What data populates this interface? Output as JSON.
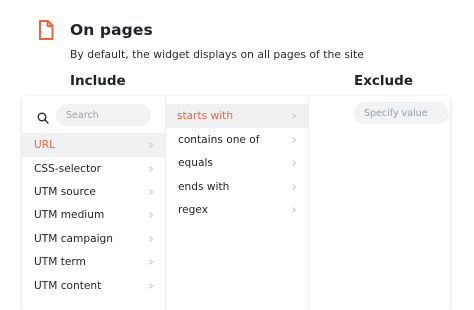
{
  "header": {
    "title": "On pages",
    "subtitle": "By default, the widget displays on all pages of the site",
    "icon": "file-icon",
    "accent_color": "#e8643c"
  },
  "columns": {
    "include_label": "Include",
    "exclude_label": "Exclude"
  },
  "search": {
    "placeholder": "Search"
  },
  "fields": {
    "selected": "URL",
    "items": [
      {
        "label": "URL"
      },
      {
        "label": "CSS-selector"
      },
      {
        "label": "UTM source"
      },
      {
        "label": "UTM medium"
      },
      {
        "label": "UTM campaign"
      },
      {
        "label": "UTM term"
      },
      {
        "label": "UTM content"
      }
    ]
  },
  "operators": {
    "selected": "starts with",
    "items": [
      {
        "label": "starts with"
      },
      {
        "label": "contains one of"
      },
      {
        "label": "equals"
      },
      {
        "label": "ends with"
      },
      {
        "label": "regex"
      }
    ]
  },
  "value": {
    "placeholder": "Specify value"
  }
}
